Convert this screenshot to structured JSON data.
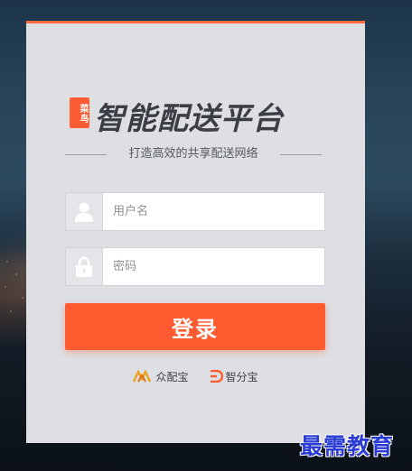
{
  "brand": {
    "badge": "菜鸟",
    "title": "智能配送平台",
    "subtitle": "打造高效的共享配送网络"
  },
  "form": {
    "username_placeholder": "用户名",
    "username_value": "",
    "password_placeholder": "密码",
    "password_value": "",
    "login_label": "登录"
  },
  "partners": [
    {
      "name": "众配宝",
      "icon": "zhongpeibao-logo-icon",
      "color": "#f0a020"
    },
    {
      "name": "智分宝",
      "icon": "zhifenbao-logo-icon",
      "color": "#ff5a30"
    }
  ],
  "watermark": "最需教育",
  "colors": {
    "accent": "#ff5a30",
    "panel": "#dddfe3",
    "watermark": "#2a3bd4"
  }
}
